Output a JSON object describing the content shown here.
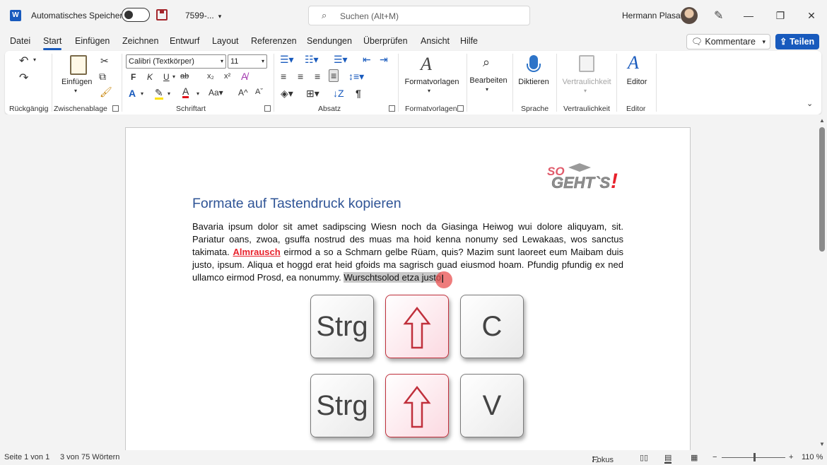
{
  "titlebar": {
    "app_icon": "W",
    "autosave_label": "Automatisches Speichern",
    "autosave_state": "off",
    "doc_name": "7599-...",
    "search_placeholder": "Suchen (Alt+M)",
    "user_name": "Hermann Plasa",
    "minimize": "—",
    "restore": "❐",
    "close": "✕"
  },
  "menu": {
    "tabs": [
      "Datei",
      "Start",
      "Einfügen",
      "Zeichnen",
      "Entwurf",
      "Layout",
      "Referenzen",
      "Sendungen",
      "Überprüfen",
      "Ansicht",
      "Hilfe"
    ],
    "active_tab": "Start",
    "comments_label": "Kommentare",
    "share_label": "Teilen"
  },
  "ribbon": {
    "undo_group_label": "Rückgängig",
    "clipboard_group_label": "Zwischenablage",
    "paste_label": "Einfügen",
    "font_group_label": "Schriftart",
    "font_name": "Calibri (Textkörper)",
    "font_size": "11",
    "paragraph_group_label": "Absatz",
    "styles_label": "Formatvorlagen",
    "styles_group_label": "Formatvorlagen",
    "edit_label": "Bearbeiten",
    "dictate_label": "Diktieren",
    "voice_group_label": "Sprache",
    "sensitivity_label": "Vertraulichkeit",
    "sensitivity_group_label": "Vertraulichkeit",
    "editor_label": "Editor",
    "editor_group_label": "Editor",
    "bold": "F",
    "italic": "K",
    "underline": "U",
    "strike": "ab",
    "subscript": "x₂",
    "superscript": "x²"
  },
  "document": {
    "logo_text_1": "SO",
    "logo_text_2": "GEHT`S",
    "logo_text_3": "!",
    "heading": "Formate auf Tastendruck kopieren",
    "para_part1": "Bavaria ipsum dolor sit amet sadipscing Wiesn noch da Giasinga Heiwog wui dolore aliquyam, sit. Pariatur oans, zwoa, gsuffa nostrud des muas ma hoid kenna nonumy sed Lewakaas, wos sanctus takimata. ",
    "para_highlight": "Almrausch",
    "para_part2": " eirmod a so a Schmarn gelbe Rüam, quis? Mazim sunt laoreet eum Maibam duis justo, ipsum. Aliqua et hoggd erat heid gfoids ma sagrisch guad eiusmod hoam. Pfundig pfundig ex ned ullamco eirmod Prosd, ea nonummy. ",
    "para_selected": "Wurschtsolod etza justo",
    "para_end": "!",
    "keys_row1": [
      "Strg",
      "shift-arrow",
      "C"
    ],
    "keys_row2": [
      "Strg",
      "shift-arrow",
      "V"
    ]
  },
  "statusbar": {
    "page_info": "Seite 1 von 1",
    "word_count": "3 von 75 Wörtern",
    "focus_label": "Fokus",
    "zoom_minus": "−",
    "zoom_plus": "+",
    "zoom_level": "110 %",
    "zoom_fraction": 0.5
  },
  "colors": {
    "accent": "#185abd",
    "heading": "#2f5496",
    "highlight_red": "#e8212b",
    "shift_key_border": "#c0303c"
  }
}
